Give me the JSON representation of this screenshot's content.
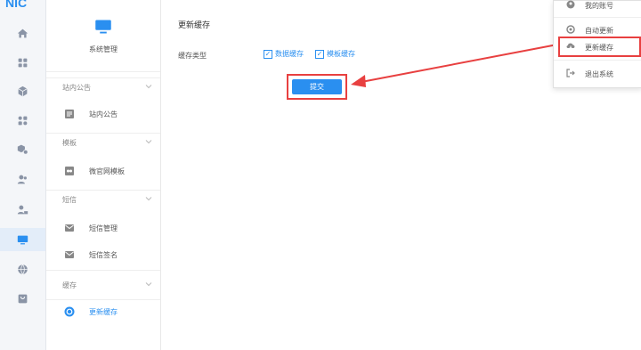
{
  "brand": {
    "logo": "NIC"
  },
  "rail_icons": [
    "home-icon",
    "grid-icon",
    "cube-icon",
    "apps-icon",
    "settings-cube-icon",
    "users-icon",
    "user-lock-icon",
    "monitor-icon",
    "globe-icon",
    "bag-icon"
  ],
  "sidebar": {
    "header": "系统管理",
    "groups": [
      {
        "label": "站内公告",
        "items": [
          {
            "label": "站内公告",
            "icon": "notice-icon"
          }
        ]
      },
      {
        "label": "模板",
        "items": [
          {
            "label": "微官网模板",
            "icon": "template-icon"
          }
        ]
      },
      {
        "label": "短信",
        "items": [
          {
            "label": "短信管理",
            "icon": "mail-icon"
          },
          {
            "label": "短信签名",
            "icon": "mail-sign-icon"
          }
        ]
      },
      {
        "label": "缓存",
        "items": [
          {
            "label": "更新缓存",
            "icon": "refresh-icon",
            "active": true
          }
        ]
      }
    ]
  },
  "main": {
    "title": "更新缓存",
    "field_label": "缓存类型",
    "options": [
      {
        "label": "数据缓存",
        "checked": true
      },
      {
        "label": "模板缓存",
        "checked": true
      }
    ],
    "submit_label": "提交"
  },
  "dropdown": {
    "items": [
      {
        "label": "我的账号",
        "icon": "account-icon"
      },
      {
        "label": "自动更新",
        "icon": "update-icon"
      },
      {
        "label": "更新缓存",
        "icon": "cloud-download-icon"
      },
      {
        "label": "退出系统",
        "icon": "logout-icon"
      }
    ]
  },
  "colors": {
    "accent": "#2a8ff0",
    "highlight": "#e84040"
  }
}
